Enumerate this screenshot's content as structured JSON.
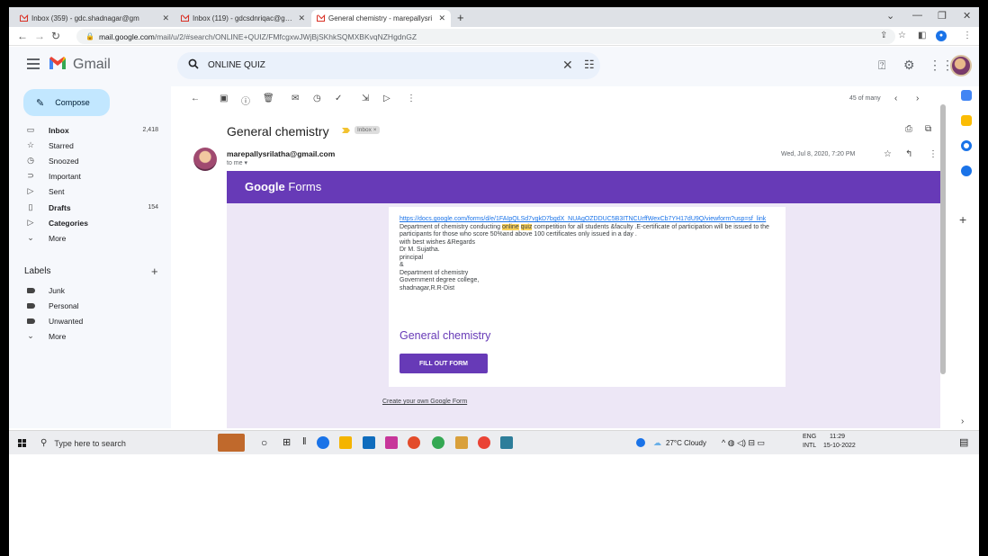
{
  "browser": {
    "tabs": [
      {
        "label": "Inbox (359) - gdc.shadnagar@gm",
        "active": false
      },
      {
        "label": "Inbox (119) - gdcsdnriqac@gmai",
        "active": false
      },
      {
        "label": "General chemistry - marepallysri",
        "active": true
      }
    ],
    "new_tab": "+",
    "url_host": "mail.google.com",
    "url_path": "/mail/u/2/#search/ONLINE+QUIZ/FMfcgxwJWjBjSKhkSQMXBKvqNZHgdnGZ"
  },
  "gmail": {
    "logo_text": "Gmail",
    "search_query": "ONLINE QUIZ",
    "compose_label": "Compose",
    "nav": [
      {
        "label": "Inbox",
        "count": "2,418",
        "bold": true,
        "icon": "inbox-icon",
        "glyph": "▭"
      },
      {
        "label": "Starred",
        "count": "",
        "bold": false,
        "icon": "star-icon",
        "glyph": "☆"
      },
      {
        "label": "Snoozed",
        "count": "",
        "bold": false,
        "icon": "clock-icon",
        "glyph": "◷"
      },
      {
        "label": "Important",
        "count": "",
        "bold": false,
        "icon": "important-icon",
        "glyph": "⊃"
      },
      {
        "label": "Sent",
        "count": "",
        "bold": false,
        "icon": "send-icon",
        "glyph": "▷"
      },
      {
        "label": "Drafts",
        "count": "154",
        "bold": true,
        "icon": "draft-icon",
        "glyph": "▯"
      },
      {
        "label": "Categories",
        "count": "",
        "bold": true,
        "icon": "label-icon",
        "glyph": "▷"
      },
      {
        "label": "More",
        "count": "",
        "bold": false,
        "icon": "chevron-down-icon",
        "glyph": "⌄"
      }
    ],
    "labels_heading": "Labels",
    "labels": [
      {
        "label": "Junk"
      },
      {
        "label": "Personal"
      },
      {
        "label": "Unwanted"
      },
      {
        "label": "More"
      }
    ]
  },
  "message": {
    "count_text": "45 of many",
    "subject": "General chemistry",
    "badge": "Inbox ×",
    "sender": "marepallysrilatha@gmail.com",
    "to": "to me ▾",
    "date": "Wed, Jul 8, 2020, 7:20 PM",
    "forms_brand_bold": "Google",
    "forms_brand_rest": " Forms",
    "link": "https://docs.google.com/forms/d/e/1FAIpQLSd7vgkD7bgdX_NUAgOZDDUC5B3ITNCUrffWexCb7YH17dU9Q/viewform?usp=sf_link",
    "body_pre": "Department of chemistry conducting ",
    "body_hl1": "online",
    "body_hl2": "quiz",
    "body_post": " competition for all students &faculty .E-certificate of participation will be issued to the participants for those who score 50%and above 100 certificates only issued in a day .",
    "lines": [
      "with best wishes &Regards",
      "Dr M. Sujatha.",
      "principal",
      "&",
      "Department of chemistry",
      "Government degree college,",
      "shadnagar,R.R-Dist"
    ],
    "form_title": "General chemistry",
    "fill_button": "FILL OUT FORM",
    "create_link": "Create your own Google Form"
  },
  "taskbar": {
    "search_placeholder": "Type here to search",
    "weather": "27°C Cloudy",
    "lang_top": "ENG",
    "lang_bottom": "INTL",
    "time": "11:29",
    "date": "15-10-2022"
  },
  "colors": {
    "forms_purple": "#673ab7",
    "forms_bg": "#ede7f6",
    "highlight": "#fbd35a",
    "compose_bg": "#c2e7ff"
  }
}
